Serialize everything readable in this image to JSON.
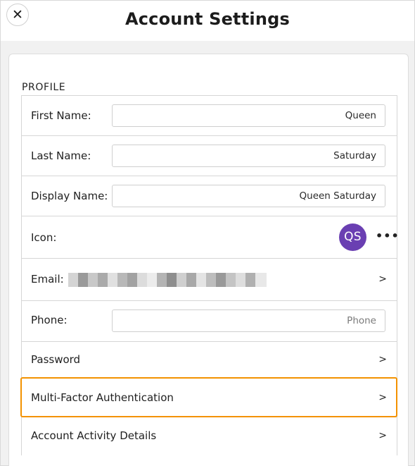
{
  "header": {
    "title": "Account Settings",
    "close_icon": "close-icon",
    "close_glyph": "✕"
  },
  "profile": {
    "section_label": "PROFILE",
    "first_name": {
      "label": "First Name:",
      "value": "Queen"
    },
    "last_name": {
      "label": "Last Name:",
      "value": "Saturday"
    },
    "display_name": {
      "label": "Display Name:",
      "value": "Queen Saturday"
    },
    "icon": {
      "label": "Icon:",
      "initials": "QS",
      "avatar_color": "#6a3fb2",
      "more_glyph": "•••"
    },
    "email": {
      "label": "Email:",
      "chevron": ">"
    },
    "phone": {
      "label": "Phone:",
      "placeholder": "Phone"
    },
    "password": {
      "label": "Password",
      "chevron": ">"
    },
    "mfa": {
      "label": "Multi-Factor Authentication",
      "chevron": ">"
    },
    "activity": {
      "label": "Account Activity Details",
      "chevron": ">"
    }
  },
  "colors": {
    "accent_highlight": "#f39200",
    "avatar": "#6a3fb2"
  }
}
